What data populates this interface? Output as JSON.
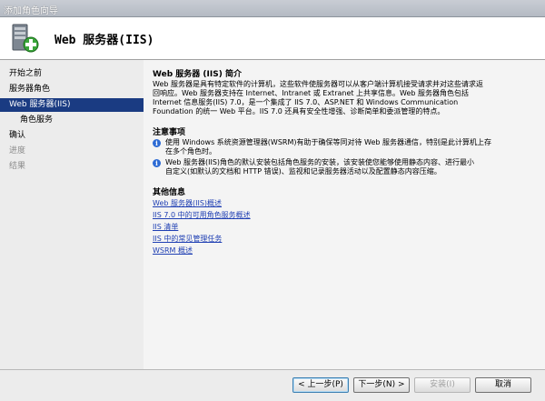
{
  "window": {
    "title": "添加角色向导"
  },
  "banner": {
    "heading": "Web 服务器(IIS)"
  },
  "sidebar": {
    "items": [
      {
        "label": "开始之前",
        "state": "normal"
      },
      {
        "label": "服务器角色",
        "state": "normal"
      },
      {
        "label": "Web 服务器(IIS)",
        "state": "active"
      },
      {
        "label": "角色服务",
        "state": "sub"
      },
      {
        "label": "确认",
        "state": "normal"
      },
      {
        "label": "进度",
        "state": "disabled"
      },
      {
        "label": "结果",
        "state": "disabled"
      }
    ]
  },
  "main": {
    "intro_title": "Web 服务器 (IIS) 简介",
    "intro_text": "Web 服务器是具有特定软件的计算机，这些软件使服务器可以从客户端计算机接受请求并对这些请求返\n回响应。Web 服务器支持在 Internet、Intranet 或 Extranet 上共享信息。Web 服务器角色包括\nInternet 信息服务(IIS) 7.0，是一个集成了 IIS 7.0、ASP.NET 和 Windows Communication\nFoundation 的统一 Web 平台。IIS 7.0 还具有安全性增强、诊断简单和委派管理的特点。",
    "notes_title": "注意事项",
    "notes": [
      "使用 Windows 系统资源管理器(WSRM)有助于确保等同对待 Web 服务器通信，特别是此计算机上存\n在多个角色时。",
      "Web 服务器(IIS)角色的默认安装包括角色服务的安装，该安装使您能够使用静态内容、进行最小\n自定义(如默认的文档和 HTTP 错误)、监视和记录服务器活动以及配置静态内容压缩。"
    ],
    "more_title": "其他信息",
    "links": [
      "Web 服务器(IIS)概述",
      "IIS 7.0 中的可用角色服务概述",
      "IIS 清单",
      "IIS 中的常见管理任务",
      "WSRM 概述"
    ]
  },
  "footer": {
    "prev": "< 上一步(P)",
    "next": "下一步(N) >",
    "install": "安装(I)",
    "cancel": "取消"
  }
}
